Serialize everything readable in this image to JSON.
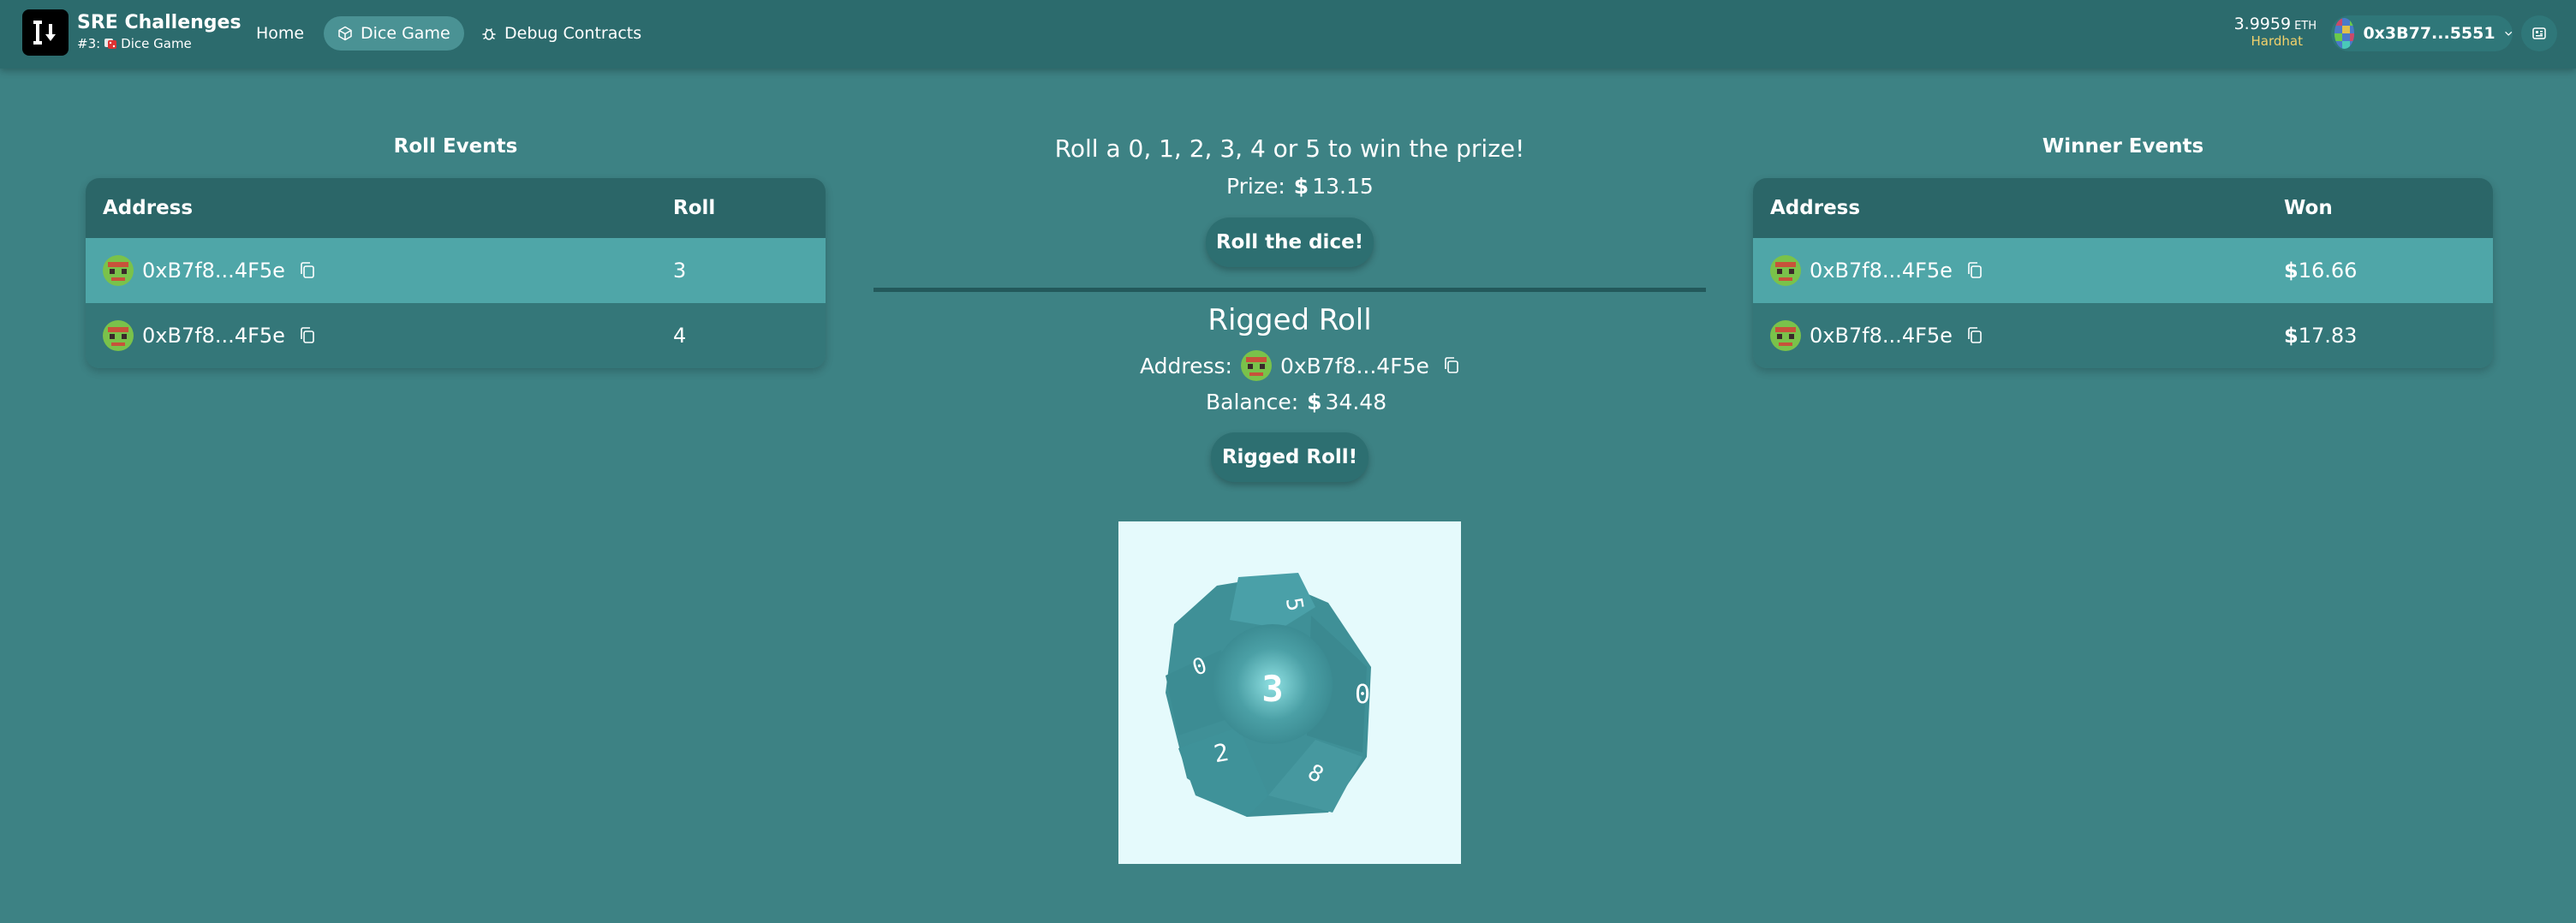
{
  "header": {
    "brand_title": "SRE Challenges",
    "brand_prefix": "#3:",
    "brand_name": "Dice Game",
    "nav": [
      {
        "label": "Home",
        "active": false
      },
      {
        "label": "Dice Game",
        "active": true
      },
      {
        "label": "Debug Contracts",
        "active": false
      }
    ],
    "balance": "3.9959",
    "balance_unit": "ETH",
    "network": "Hardhat",
    "account": "0x3B77...5551"
  },
  "roll_events": {
    "title": "Roll Events",
    "columns": [
      "Address",
      "Roll"
    ],
    "rows": [
      {
        "address": "0xB7f8...4F5e",
        "value": "3"
      },
      {
        "address": "0xB7f8...4F5e",
        "value": "4"
      }
    ]
  },
  "center": {
    "headline": "Roll a 0, 1, 2, 3, 4 or 5 to win the prize!",
    "prize_label": "Prize:",
    "prize_currency": "$",
    "prize_value": "13.15",
    "roll_button": "Roll the dice!",
    "rigged_title": "Rigged Roll",
    "address_label": "Address:",
    "rigged_address": "0xB7f8...4F5e",
    "balance_label": "Balance:",
    "balance_currency": "$",
    "balance_value": "34.48",
    "rigged_button": "Rigged Roll!",
    "dice_faces": [
      "5",
      "3",
      "0",
      "2",
      "8",
      "0"
    ]
  },
  "winner_events": {
    "title": "Winner Events",
    "columns": [
      "Address",
      "Won"
    ],
    "rows": [
      {
        "address": "0xB7f8...4F5e",
        "currency": "$",
        "value": "16.66"
      },
      {
        "address": "0xB7f8...4F5e",
        "currency": "$",
        "value": "17.83"
      }
    ]
  },
  "colors": {
    "background": "#3d8284",
    "header": "#2c6b6d",
    "highlight_row": "#4fa6a8",
    "network": "#f2d16b"
  }
}
